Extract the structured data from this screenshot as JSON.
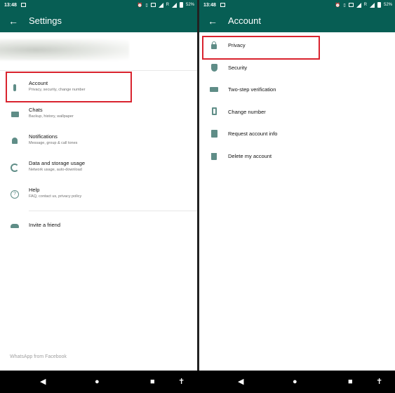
{
  "left_screen": {
    "status": {
      "time": "13:48",
      "battery": "52%",
      "network": "R"
    },
    "header": {
      "back_icon": "arrow-left-icon",
      "title": "Settings"
    },
    "items": [
      {
        "label": "Account",
        "sub": "Privacy, security, change number",
        "icon": "key-icon"
      },
      {
        "label": "Chats",
        "sub": "Backup, history, wallpaper",
        "icon": "chat-icon"
      },
      {
        "label": "Notifications",
        "sub": "Message, group & call tones",
        "icon": "bell-icon"
      },
      {
        "label": "Data and storage usage",
        "sub": "Network usage, auto-download",
        "icon": "data-usage-icon"
      },
      {
        "label": "Help",
        "sub": "FAQ, contact us, privacy policy",
        "icon": "help-icon"
      },
      {
        "label": "Invite a friend",
        "icon": "people-icon"
      }
    ],
    "footer": "WhatsApp from Facebook"
  },
  "right_screen": {
    "status": {
      "time": "13:48",
      "battery": "52%",
      "network": "R"
    },
    "header": {
      "back_icon": "arrow-left-icon",
      "title": "Account"
    },
    "items": [
      {
        "label": "Privacy",
        "icon": "lock-icon"
      },
      {
        "label": "Security",
        "icon": "shield-icon"
      },
      {
        "label": "Two-step verification",
        "icon": "dots-icon"
      },
      {
        "label": "Change number",
        "icon": "phone-change-icon"
      },
      {
        "label": "Request account info",
        "icon": "document-icon"
      },
      {
        "label": "Delete my account",
        "icon": "trash-icon"
      }
    ]
  },
  "navbar": {
    "icons": [
      "back-triangle-icon",
      "home-circle-icon",
      "recents-square-icon",
      "accessibility-icon"
    ]
  },
  "colors": {
    "header": "#075e54",
    "icon": "#5f8d87",
    "highlight": "#d9232e"
  }
}
